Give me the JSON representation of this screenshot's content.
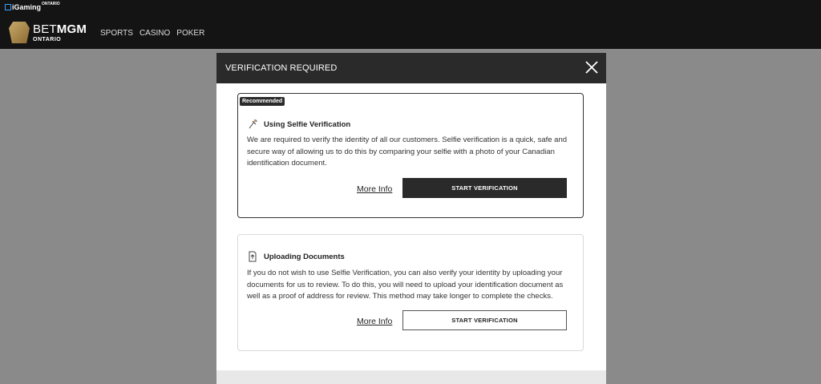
{
  "header": {
    "igaming_logo": "iGaming",
    "igaming_sup": "ONTARIO",
    "brand_bet": "BET",
    "brand_mgm": "MGM",
    "brand_region": "ONTARIO",
    "nav": [
      "SPORTS",
      "CASINO",
      "POKER"
    ]
  },
  "modal": {
    "title": "VERIFICATION REQUIRED",
    "selfie": {
      "badge": "Recommended",
      "title": "Using Selfie Verification",
      "description": "We are required to verify the identity of all our customers. Selfie verification is a quick, safe and secure way of allowing us to do this by comparing your selfie with a photo of your Canadian identification document.",
      "more_info": "More Info",
      "button": "START VERIFICATION"
    },
    "documents": {
      "title": "Uploading Documents",
      "description": "If you do not wish to use Selfie Verification, you can also verify your identity by uploading your documents for us to review. To do this, you will need to upload your identification document as well as a proof of address for review. This method may take longer to complete the checks.",
      "more_info": "More Info",
      "button": "START VERIFICATION"
    }
  },
  "colors": {
    "header_bg": "#141414",
    "overlay": "#8a8a8a",
    "modal_header": "#2a2a2a",
    "brand_gold": "#c9a86a"
  }
}
